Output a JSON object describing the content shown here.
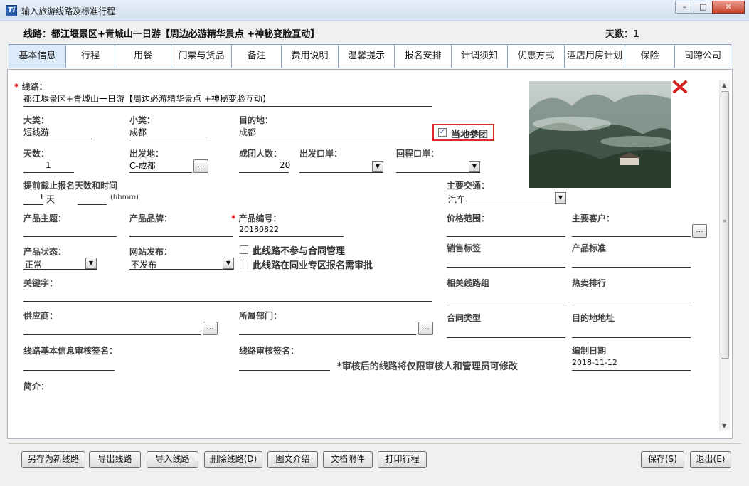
{
  "window": {
    "title": "输入旅游线路及标准行程",
    "icon_text": "Ti",
    "minimize": "–",
    "maximize": "□",
    "close": "✕"
  },
  "header": {
    "route": "线路：都江堰景区+青城山一日游【周边必游精华景点 +神秘变脸互动】",
    "days": "天数：1"
  },
  "tabs": [
    "基本信息",
    "行程",
    "用餐",
    "门票与货品",
    "备注",
    "费用说明",
    "温馨提示",
    "报名安排",
    "计调须知",
    "优惠方式",
    "酒店用房计划",
    "保险",
    "司跨公司"
  ],
  "form": {
    "required_mark": "*",
    "route_label": "线路：",
    "route_value": "都江堰景区+青城山一日游【周边必游精华景点 +神秘变脸互动】",
    "category_label": "大类：",
    "category_value": "短线游",
    "subcategory_label": "小类：",
    "subcategory_value": "成都",
    "destination_label": "目的地：",
    "destination_value": "成都",
    "local_group_label": "当地参团",
    "local_group_checked": true,
    "days_label": "天数：",
    "days_value": "1",
    "departure_label": "出发地：",
    "departure_value": "C-成都",
    "group_size_label": "成团人数：",
    "group_size_value": "20",
    "depart_port_label": "出发口岸：",
    "depart_port_value": "",
    "return_port_label": "回程口岸：",
    "return_port_value": "",
    "deadline_label": "提前截止报名天数和时间",
    "deadline_days_value": "1",
    "deadline_days_unit": "天",
    "deadline_time_hint": "(hhmm)",
    "transport_label": "主要交通：",
    "transport_value": "汽车",
    "theme_label": "产品主题：",
    "brand_label": "产品品牌：",
    "product_code_label": "产品编号：",
    "product_code_value": "20180822",
    "price_range_label": "价格范围：",
    "main_customer_label": "主要客户：",
    "status_label": "产品状态：",
    "status_value": "正常",
    "web_publish_label": "网站发布：",
    "web_publish_value": "不发布",
    "no_contract_label": "此线路不参与合同管理",
    "peer_review_label": "此线路在同业专区报名需审批",
    "sales_tag_label": "销售标签",
    "product_standard_label": "产品标准",
    "keywords_label": "关键字：",
    "related_routes_label": "相关线路组",
    "hot_rank_label": "热卖排行",
    "supplier_label": "供应商：",
    "department_label": "所属部门：",
    "contract_type_label": "合同类型",
    "destination_address_label": "目的地地址",
    "basic_sign_label": "线路基本信息审核签名：",
    "route_sign_label": "线路审核签名：",
    "review_note": "*审核后的线路将仅限审核人和管理员可修改",
    "compile_date_label": "编制日期",
    "compile_date_value": "2018-11-12",
    "intro_label": "简介：",
    "ellipsis": "..."
  },
  "buttons": {
    "save_as_new": "另存为新线路",
    "export": "导出线路",
    "import": "导入线路",
    "delete": "删除线路(D)",
    "graphic_intro": "图文介绍",
    "attachments": "文档附件",
    "print": "打印行程",
    "save": "保存(S)",
    "exit": "退出(E)"
  },
  "colors": {
    "accent_red": "#e0292b",
    "tab_active": "#dcebf9",
    "checkbox_check": "#264b9e"
  },
  "icons": {
    "dropdown": "▼",
    "scroll_up": "▲",
    "scroll_down": "▼",
    "scroll_grip": "≡",
    "check": "✓"
  }
}
